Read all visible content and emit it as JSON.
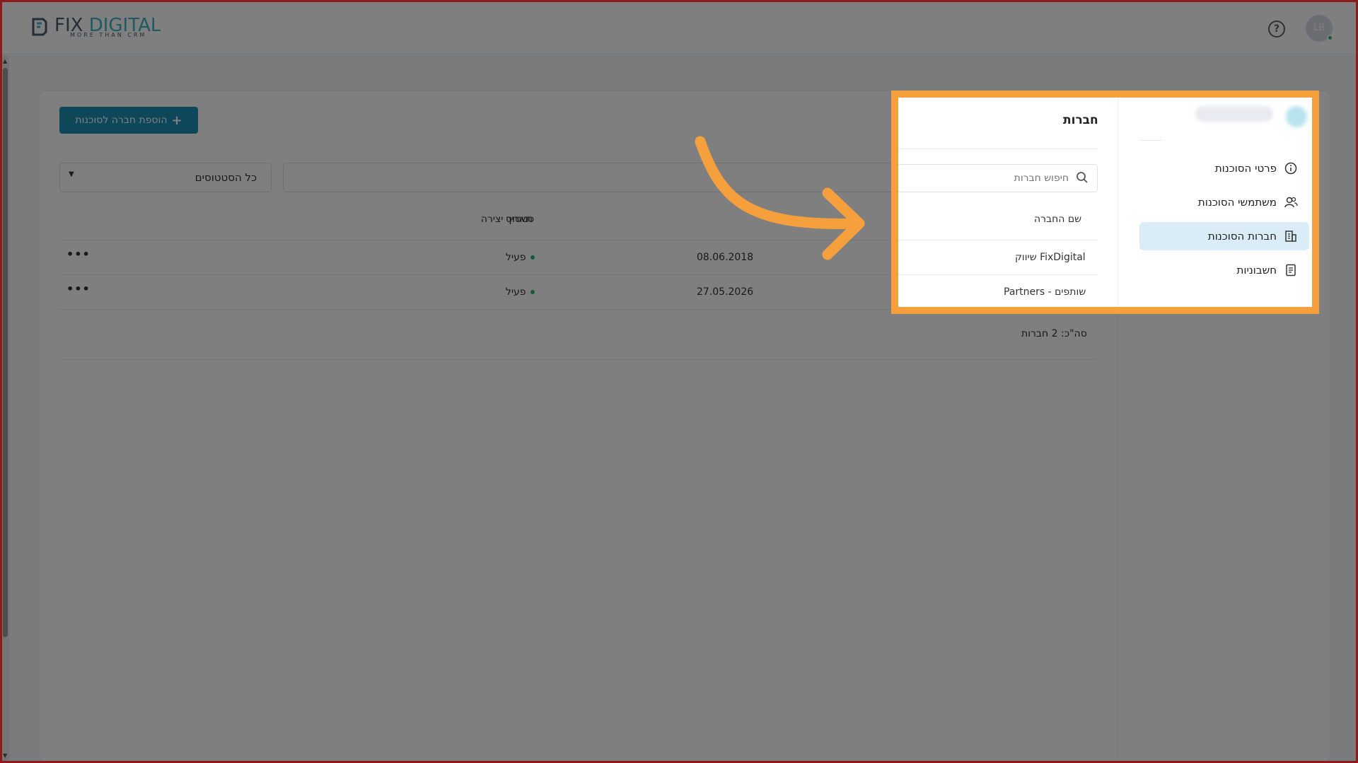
{
  "header": {
    "logo_main": "FIX",
    "logo_accent": "DIGITAL",
    "logo_sub": "MORE THAN CRM",
    "help_icon": "question-circle-icon",
    "avatar_initials": "LB"
  },
  "toolbar": {
    "add_button_label": "הוספת חברה לסוכנות",
    "status_filter_value": "כל הסטטוסים"
  },
  "companies": {
    "title": "חברות",
    "search_placeholder": "חיפוש חברות",
    "columns": {
      "name": "שם החברה",
      "created": "תאריך יצירה",
      "status": "סטטוס"
    },
    "rows": [
      {
        "name": "FixDigital שיווק",
        "created": "08.06.2018",
        "status": "פעיל",
        "actions": "•••"
      },
      {
        "name": "שותפים - Partners",
        "created": "27.05.2026",
        "status": "פעיל",
        "actions": "•••"
      }
    ],
    "total": "סה\"כ: 2 חברות"
  },
  "sidebar": {
    "items": [
      {
        "label": "פרטי הסוכנות",
        "icon": "info-icon"
      },
      {
        "label": "משתמשי הסוכנות",
        "icon": "users-icon"
      },
      {
        "label": "חברות הסוכנות",
        "icon": "building-icon",
        "active": true
      },
      {
        "label": "חשבוניות",
        "icon": "invoice-icon"
      }
    ]
  },
  "colors": {
    "primary": "#1d8fb3",
    "highlight": "#f5a03c",
    "active_bg": "#d9ecf8",
    "status_active": "#2bb673"
  }
}
